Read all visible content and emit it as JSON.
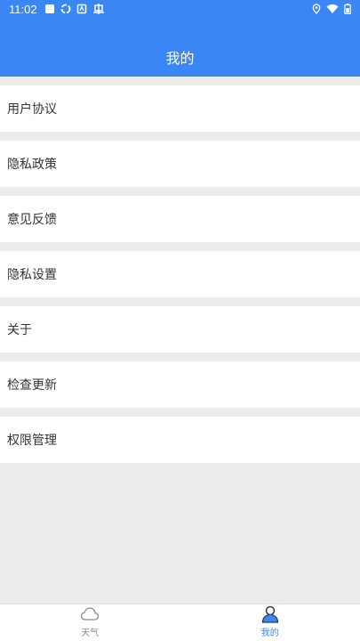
{
  "status_bar": {
    "time": "11:02",
    "left_icons": [
      "square-icon",
      "sync-icon",
      "android-icon",
      "bug-icon"
    ],
    "right_icons": [
      "location-icon",
      "wifi-icon",
      "battery-icon"
    ]
  },
  "header": {
    "title": "我的",
    "color": "#3a86f5"
  },
  "menu": {
    "items": [
      {
        "label": "用户协议"
      },
      {
        "label": "隐私政策"
      },
      {
        "label": "意见反馈"
      },
      {
        "label": "隐私设置"
      },
      {
        "label": "关于"
      },
      {
        "label": "检查更新"
      },
      {
        "label": "权限管理"
      }
    ]
  },
  "tabbar": {
    "tabs": [
      {
        "label": "天气",
        "icon": "cloud-icon",
        "active": false
      },
      {
        "label": "我的",
        "icon": "user-icon",
        "active": true
      }
    ],
    "active_color": "#3a86f5",
    "inactive_color": "#8a8a8a"
  }
}
